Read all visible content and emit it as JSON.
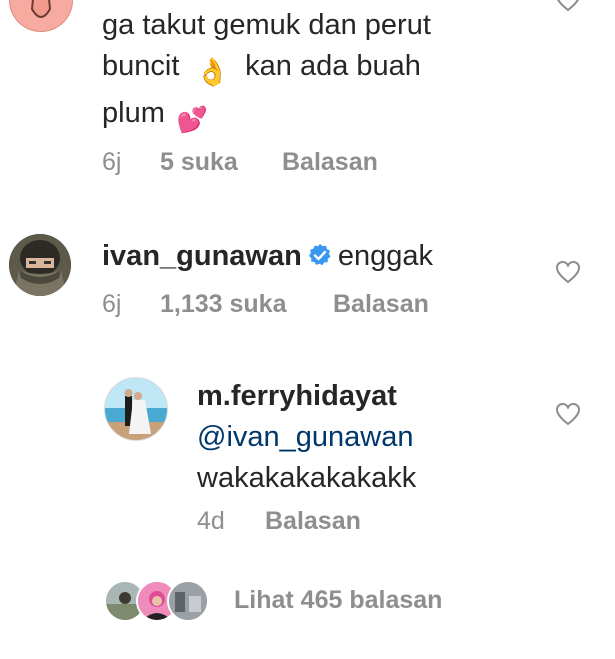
{
  "comment1": {
    "text_lines": [
      "ga takut gemuk dan perut",
      "buncit",
      "kan ada buah",
      "plum"
    ],
    "emoji_ok": "👌",
    "emoji_hearts": "💕",
    "time": "6j",
    "likes": "5 suka",
    "reply_label": "Balasan"
  },
  "comment2": {
    "username": "ivan_gunawan",
    "text": "enggak",
    "time": "6j",
    "likes": "1,133 suka",
    "reply_label": "Balasan"
  },
  "reply1": {
    "username": "m.ferryhidayat",
    "mention": "@ivan_gunawan",
    "text": "wakakakakakakk",
    "time": "4d",
    "reply_label": "Balasan"
  },
  "view_replies": {
    "label": "Lihat 465 balasan"
  },
  "icons": {
    "heart": "heart-outline-icon",
    "verified": "verified-badge-icon"
  },
  "colors": {
    "text": "#262626",
    "meta": "#8e8e8e",
    "mention": "#00376b",
    "verified": "#3897f0"
  }
}
